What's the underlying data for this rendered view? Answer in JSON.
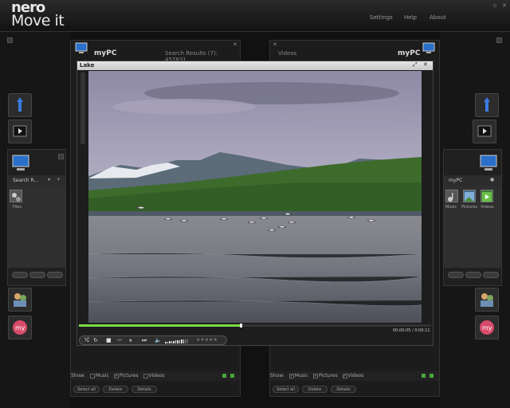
{
  "app": {
    "logo_top": "nero",
    "logo_bottom": "Move it",
    "nav": [
      "Settings",
      "Help",
      "About"
    ],
    "window_buttons": [
      "▫",
      "✕"
    ]
  },
  "left_side": {
    "library": {
      "header": "Search R...",
      "item_label": "Files"
    }
  },
  "right_side": {
    "library": {
      "header": "myPC",
      "items": [
        "Music",
        "Pictures",
        "Videos"
      ]
    }
  },
  "left_panel": {
    "title": "myPC",
    "subtitle": "Search Results (7): 457831",
    "show_label": "Show:",
    "filters": [
      {
        "label": "Music",
        "checked": false
      },
      {
        "label": "Pictures",
        "checked": true
      },
      {
        "label": "Videos",
        "checked": false
      }
    ],
    "buttons": [
      "Select all",
      "Delete",
      "Details"
    ]
  },
  "right_panel": {
    "title": "myPC",
    "subtitle": "Videos",
    "show_label": "Show:",
    "filters": [
      {
        "label": "Music",
        "checked": true
      },
      {
        "label": "Pictures",
        "checked": true
      },
      {
        "label": "Videos",
        "checked": true
      }
    ],
    "buttons": [
      "Select all",
      "Delete",
      "Details"
    ]
  },
  "player": {
    "title": "Lake",
    "time": "00:00:05 / 0:00:11",
    "progress": 0.46,
    "volume": 0.8,
    "rating": 0
  },
  "colors": {
    "accent_green": "#7bdc44",
    "status_green": "#46a83a"
  }
}
